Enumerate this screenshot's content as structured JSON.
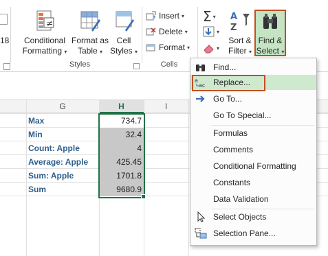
{
  "ribbon": {
    "conditional_formatting": {
      "line1": "Conditional",
      "line2": "Formatting"
    },
    "format_as_table": {
      "line1": "Format as",
      "line2": "Table"
    },
    "cell_styles": {
      "line1": "Cell",
      "line2": "Styles"
    },
    "styles_group": "Styles",
    "insert": "Insert",
    "delete": "Delete",
    "format": "Format",
    "cells_group": "Cells",
    "sort_filter": {
      "line1": "Sort &",
      "line2": "Filter"
    },
    "find_select": {
      "line1": "Find &",
      "line2": "Select"
    },
    "left_partial": "18"
  },
  "sheet": {
    "columns": [
      "G",
      "H",
      "I"
    ],
    "rows": [
      {
        "label": "Max",
        "value": "734.7"
      },
      {
        "label": "Min",
        "value": "32.4"
      },
      {
        "label": "Count: Apple",
        "value": "4"
      },
      {
        "label": "Average: Apple",
        "value": "425.45"
      },
      {
        "label": "Sum: Apple",
        "value": "1701.8"
      },
      {
        "label": "Sum",
        "value": "9680.9"
      }
    ]
  },
  "menu": {
    "items": [
      {
        "label": "Find...",
        "icon": "binoculars-icon"
      },
      {
        "label": "Replace...",
        "icon": "replace-icon"
      },
      {
        "label": "Go To...",
        "icon": "arrow-right-icon"
      },
      {
        "label": "Go To Special...",
        "icon": ""
      },
      {
        "label": "Formulas",
        "icon": ""
      },
      {
        "label": "Comments",
        "icon": ""
      },
      {
        "label": "Conditional Formatting",
        "icon": ""
      },
      {
        "label": "Constants",
        "icon": ""
      },
      {
        "label": "Data Validation",
        "icon": ""
      },
      {
        "label": "Select Objects",
        "icon": "cursor-icon"
      },
      {
        "label": "Selection Pane...",
        "icon": "selection-pane-icon"
      }
    ]
  },
  "colors": {
    "accent_border": "#c0501f",
    "highlight": "#c4e4c4",
    "label_blue": "#2e5f8e"
  }
}
